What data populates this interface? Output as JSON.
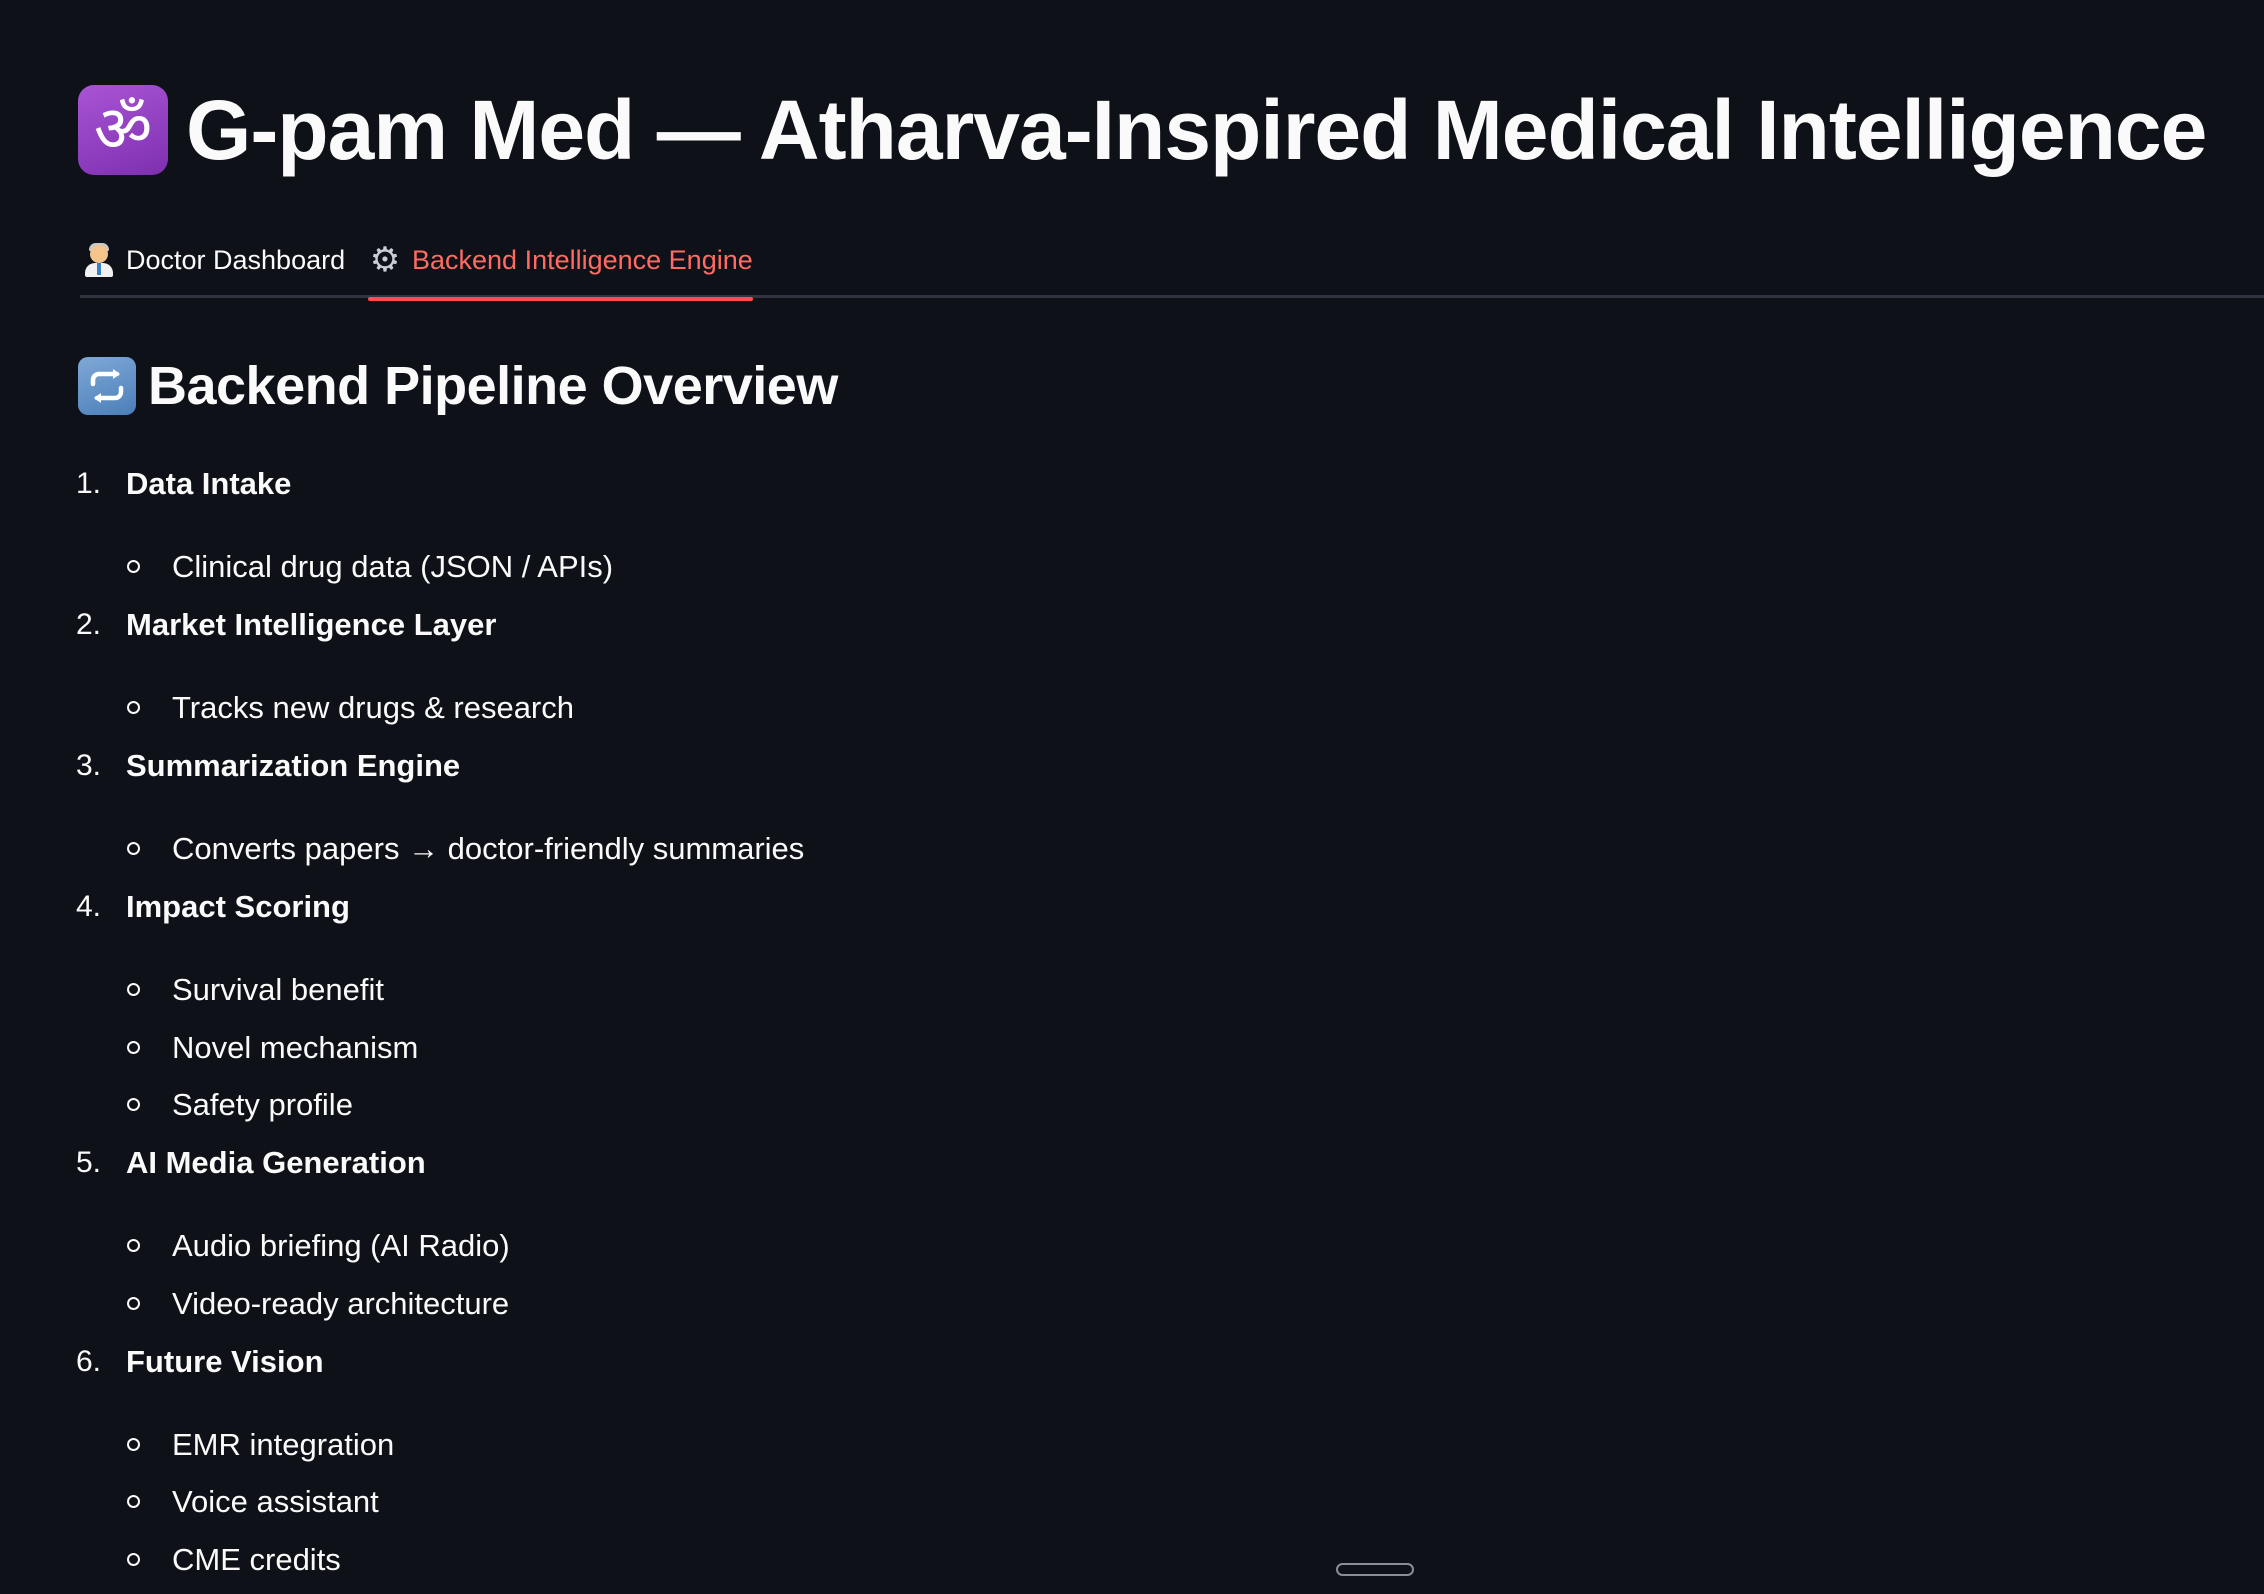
{
  "app": {
    "title": "G-pam Med — Atharva-Inspired Medical Intelligence",
    "title_icon": "om-icon",
    "title_icon_glyph": "ॐ"
  },
  "tabs": [
    {
      "label": "Doctor Dashboard",
      "icon": "doctor-icon",
      "active": false
    },
    {
      "label": "Backend Intelligence Engine",
      "icon": "gear-icon",
      "icon_glyph": "⚙",
      "active": true
    }
  ],
  "section": {
    "title": "Backend Pipeline Overview",
    "icon": "repeat-icon",
    "icon_glyph": "🔁"
  },
  "pipeline": [
    {
      "number": "1.",
      "label": "Data Intake",
      "items": [
        "Clinical drug data (JSON / APIs)"
      ]
    },
    {
      "number": "2.",
      "label": "Market Intelligence Layer",
      "items": [
        "Tracks new drugs & research"
      ]
    },
    {
      "number": "3.",
      "label": "Summarization Engine",
      "items": [
        "Converts papers → doctor-friendly summaries"
      ]
    },
    {
      "number": "4.",
      "label": "Impact Scoring",
      "items": [
        "Survival benefit",
        "Novel mechanism",
        "Safety profile"
      ]
    },
    {
      "number": "5.",
      "label": "AI Media Generation",
      "items": [
        "Audio briefing (AI Radio)",
        "Video-ready architecture"
      ]
    },
    {
      "number": "6.",
      "label": "Future Vision",
      "items": [
        "EMR integration",
        "Voice assistant",
        "CME credits"
      ]
    }
  ],
  "colors": {
    "background": "#0e1117",
    "text": "#fafafa",
    "active_tab": "#ff6b62",
    "active_tab_underline": "#ff4b4b",
    "divider": "#31333f"
  }
}
